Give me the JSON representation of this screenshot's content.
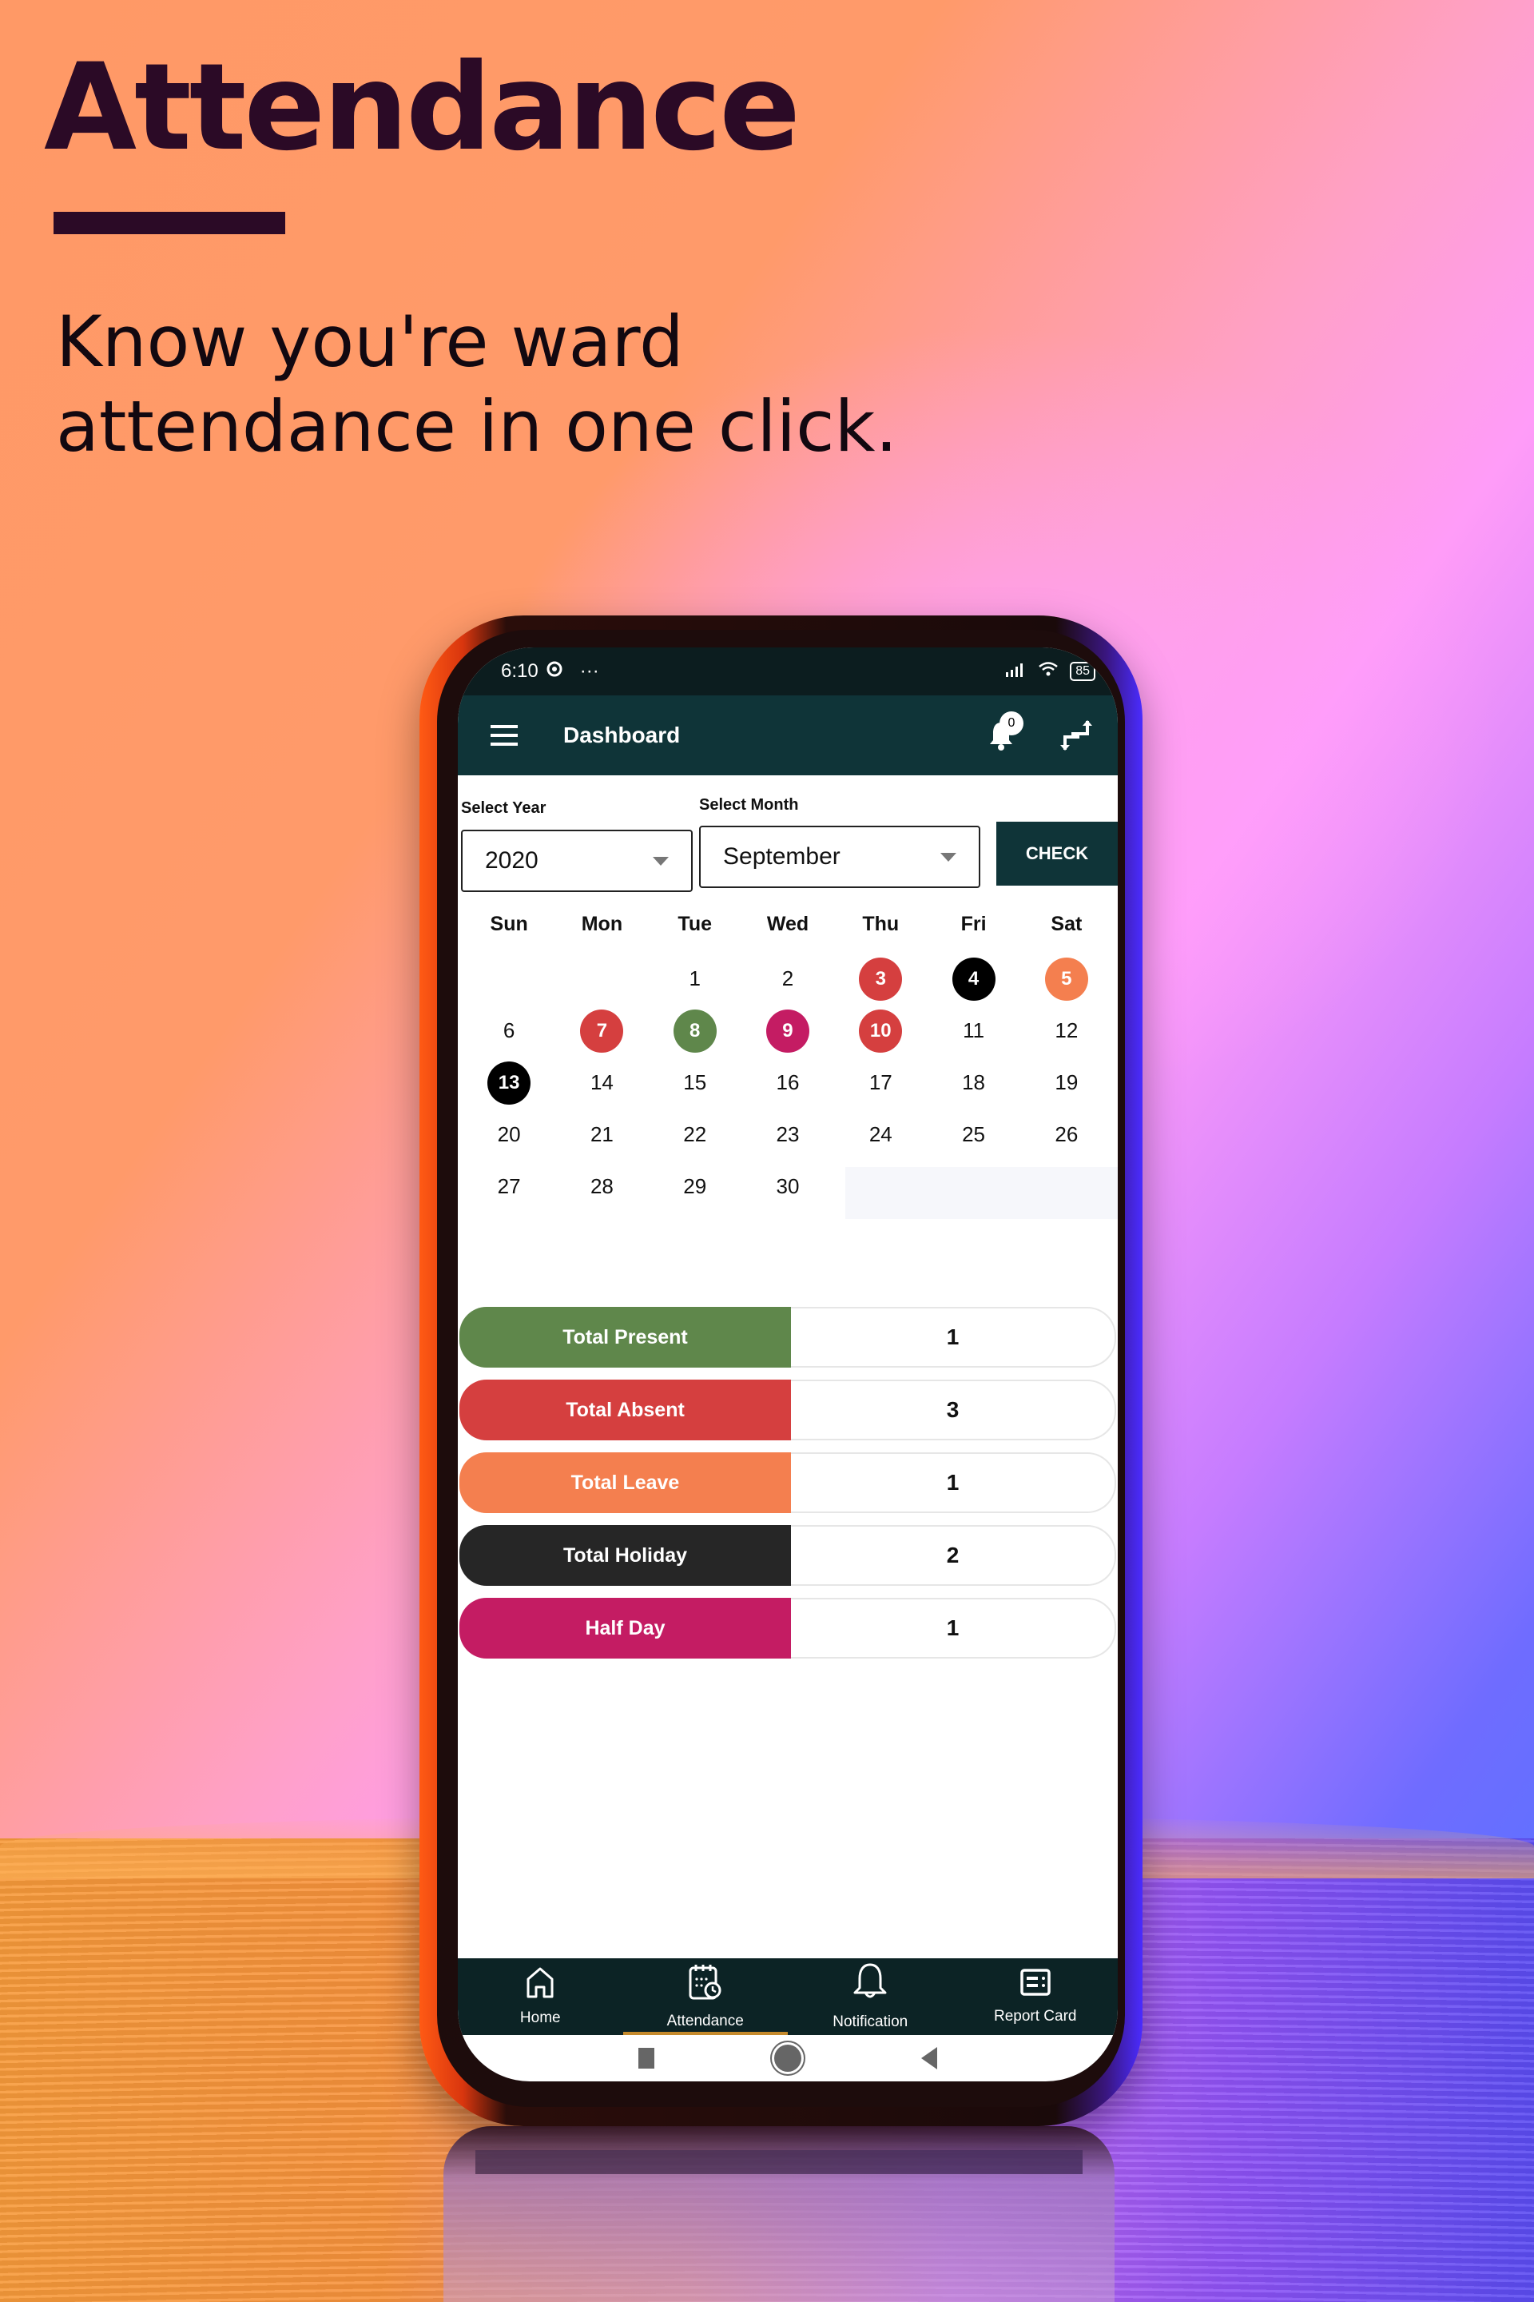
{
  "hero": {
    "title": "Attendance",
    "subtitle_line1": "Know you're ward",
    "subtitle_line2": "attendance in one click."
  },
  "status_bar": {
    "time": "6:10",
    "dots": "···",
    "battery": "85"
  },
  "app_bar": {
    "title": "Dashboard",
    "notification_count": "0"
  },
  "filters": {
    "year_label": "Select Year",
    "year_value": "2020",
    "month_label": "Select Month",
    "month_value": "September",
    "check_label": "CHECK"
  },
  "calendar": {
    "weekdays": [
      "Sun",
      "Mon",
      "Tue",
      "Wed",
      "Thu",
      "Fri",
      "Sat"
    ],
    "weeks": [
      [
        {
          "d": ""
        },
        {
          "d": ""
        },
        {
          "d": "1"
        },
        {
          "d": "2"
        },
        {
          "d": "3",
          "status": "absent"
        },
        {
          "d": "4",
          "status": "holiday"
        },
        {
          "d": "5",
          "status": "leave"
        }
      ],
      [
        {
          "d": "6"
        },
        {
          "d": "7",
          "status": "absent"
        },
        {
          "d": "8",
          "status": "present"
        },
        {
          "d": "9",
          "status": "halfday"
        },
        {
          "d": "10",
          "status": "absent"
        },
        {
          "d": "11"
        },
        {
          "d": "12"
        }
      ],
      [
        {
          "d": "13",
          "status": "holiday"
        },
        {
          "d": "14"
        },
        {
          "d": "15"
        },
        {
          "d": "16"
        },
        {
          "d": "17"
        },
        {
          "d": "18"
        },
        {
          "d": "19"
        }
      ],
      [
        {
          "d": "20"
        },
        {
          "d": "21"
        },
        {
          "d": "22"
        },
        {
          "d": "23"
        },
        {
          "d": "24"
        },
        {
          "d": "25"
        },
        {
          "d": "26"
        }
      ],
      [
        {
          "d": "27"
        },
        {
          "d": "28"
        },
        {
          "d": "29"
        },
        {
          "d": "30"
        },
        {
          "d": ""
        },
        {
          "d": ""
        },
        {
          "d": ""
        }
      ]
    ]
  },
  "status_colors": {
    "present": "#5f874b",
    "absent": "#d53f3f",
    "leave": "#f47f4f",
    "holiday": "#000000",
    "halfday": "#c41c63"
  },
  "summary": [
    {
      "label": "Total Present",
      "value": "1",
      "status": "present",
      "color": "#5f874b"
    },
    {
      "label": "Total Absent",
      "value": "3",
      "status": "absent",
      "color": "#d53f3f"
    },
    {
      "label": "Total Leave",
      "value": "1",
      "status": "leave",
      "color": "#f47f4f"
    },
    {
      "label": "Total Holiday",
      "value": "2",
      "status": "holiday",
      "color": "#262626"
    },
    {
      "label": "Half Day",
      "value": "1",
      "status": "halfday",
      "color": "#c41c63"
    }
  ],
  "bottom_nav": [
    {
      "label": "Home",
      "icon": "home-icon",
      "active": false
    },
    {
      "label": "Attendance",
      "icon": "calendar-clock-icon",
      "active": true
    },
    {
      "label": "Notification",
      "icon": "bell-icon",
      "active": false
    },
    {
      "label": "Report Card",
      "icon": "report-card-icon",
      "active": false
    }
  ],
  "theme": {
    "primary": "#0f3438",
    "nav_active_indicator": "#c58a2c",
    "hero_text": "#2b0a26"
  }
}
